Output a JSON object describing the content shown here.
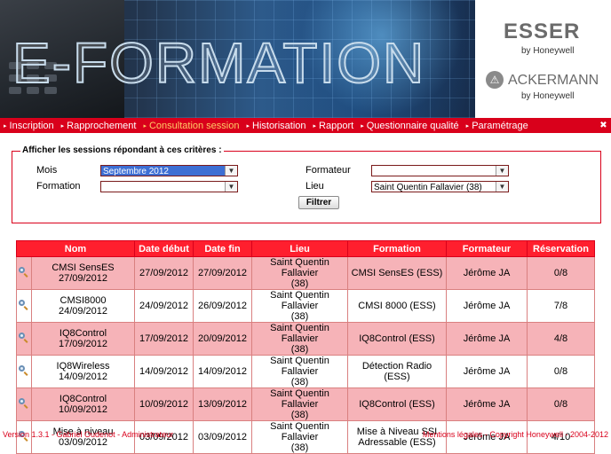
{
  "header": {
    "banner_title": "E-FORMATION",
    "logo_esser": "ESSER",
    "logo_esser_by": "by Honeywell",
    "logo_ackermann": "ACKERMANN",
    "logo_ackermann_by": "by Honeywell"
  },
  "menu": {
    "items": [
      {
        "label": "Inscription"
      },
      {
        "label": "Rapprochement"
      },
      {
        "label": "Consultation session",
        "active": true
      },
      {
        "label": "Historisation"
      },
      {
        "label": "Rapport"
      },
      {
        "label": "Questionnaire qualité"
      },
      {
        "label": "Paramétrage"
      }
    ],
    "exit_icon": "exit-icon"
  },
  "filter": {
    "legend": "Afficher les sessions répondant à ces critères :",
    "mois_label": "Mois",
    "mois_value": "Septembre 2012",
    "formation_label": "Formation",
    "formation_value": "",
    "formateur_label": "Formateur",
    "formateur_value": "",
    "lieu_label": "Lieu",
    "lieu_value": "Saint Quentin Fallavier (38)",
    "button_label": "Filtrer"
  },
  "table": {
    "columns": [
      "Nom",
      "Date début",
      "Date fin",
      "Lieu",
      "Formation",
      "Formateur",
      "Réservation"
    ],
    "rows": [
      {
        "nom1": "CMSI SensES",
        "nom2": "27/09/2012",
        "debut": "27/09/2012",
        "fin": "27/09/2012",
        "lieu1": "Saint Quentin Fallavier",
        "lieu2": "(38)",
        "formation": "CMSI SensES (ESS)",
        "formateur": "Jérôme JA",
        "reservation": "0/8"
      },
      {
        "nom1": "CMSI8000",
        "nom2": "24/09/2012",
        "debut": "24/09/2012",
        "fin": "26/09/2012",
        "lieu1": "Saint Quentin Fallavier",
        "lieu2": "(38)",
        "formation": "CMSI 8000 (ESS)",
        "formateur": "Jérôme JA",
        "reservation": "7/8"
      },
      {
        "nom1": "IQ8Control",
        "nom2": "17/09/2012",
        "debut": "17/09/2012",
        "fin": "20/09/2012",
        "lieu1": "Saint Quentin Fallavier",
        "lieu2": "(38)",
        "formation": "IQ8Control (ESS)",
        "formateur": "Jérôme JA",
        "reservation": "4/8"
      },
      {
        "nom1": "IQ8Wireless",
        "nom2": "14/09/2012",
        "debut": "14/09/2012",
        "fin": "14/09/2012",
        "lieu1": "Saint Quentin Fallavier",
        "lieu2": "(38)",
        "formation": "Détection Radio (ESS)",
        "formateur": "Jérôme JA",
        "reservation": "0/8"
      },
      {
        "nom1": "IQ8Control",
        "nom2": "10/09/2012",
        "debut": "10/09/2012",
        "fin": "13/09/2012",
        "lieu1": "Saint Quentin Fallavier",
        "lieu2": "(38)",
        "formation": "IQ8Control (ESS)",
        "formateur": "Jérôme JA",
        "reservation": "0/8"
      },
      {
        "nom1": "Mise à niveau",
        "nom2": "03/09/2012",
        "debut": "03/09/2012",
        "fin": "03/09/2012",
        "lieu1": "Saint Quentin Fallavier",
        "lieu2": "(38)",
        "formation": "Mise à Niveau SSI Adressable (ESS)",
        "formateur": "Jérôme JA",
        "reservation": "4/10"
      }
    ]
  },
  "footer": {
    "left": "Version 1.3.1 - Gabriel Oudenot - Administrateur",
    "right": "Mentions légales - Copyright Honeywell - 2004-2012"
  },
  "colors": {
    "brand_red": "#d9001b",
    "header_red": "#ff1f2e",
    "row_pink": "#f6b3b8",
    "active_menu": "#ffcc66"
  }
}
